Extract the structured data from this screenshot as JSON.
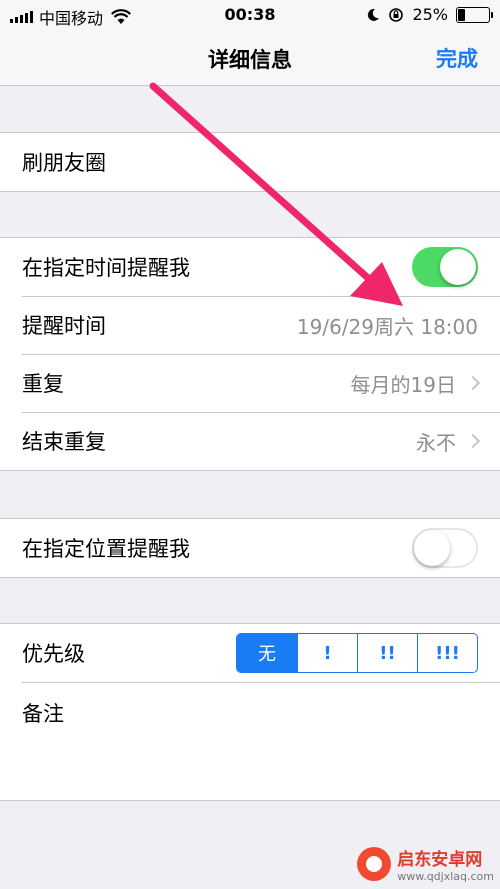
{
  "status_bar": {
    "carrier": "中国移动",
    "time": "00:38",
    "battery_percent": "25%",
    "battery_level": 0.25
  },
  "nav": {
    "title": "详细信息",
    "done_label": "完成"
  },
  "title_row": {
    "label": "刷朋友圈"
  },
  "time_group": {
    "remind_at_time": {
      "label": "在指定时间提醒我",
      "enabled": true
    },
    "reminder_time": {
      "label": "提醒时间",
      "value": "19/6/29周六 18:00"
    },
    "repeat": {
      "label": "重复",
      "value": "每月的19日"
    },
    "end_repeat": {
      "label": "结束重复",
      "value": "永不"
    }
  },
  "location_group": {
    "remind_at_location": {
      "label": "在指定位置提醒我",
      "enabled": false
    }
  },
  "priority": {
    "label": "优先级",
    "options": [
      "无",
      "!",
      "!!",
      "!!!"
    ],
    "selected_index": 0
  },
  "notes": {
    "label": "备注"
  },
  "watermark": {
    "name": "启东安卓网",
    "url": "www.qdjxlaq.com"
  },
  "colors": {
    "accent": "#1a7cf5",
    "toggle_on": "#4cd964",
    "arrow": "#f0266a"
  }
}
